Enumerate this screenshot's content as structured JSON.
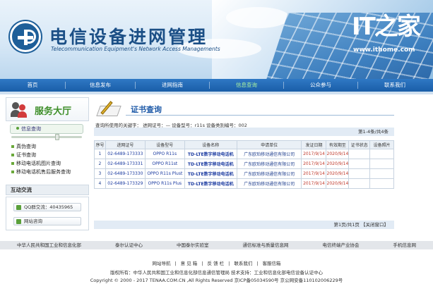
{
  "header": {
    "title": "电信设备进网管理",
    "subtitle": "Telecommunication Equipment's Network Access Managements",
    "watermark_logo": "IT之家",
    "watermark_url": "www.ithome.com"
  },
  "nav": {
    "items": [
      {
        "label": "首页",
        "active": false
      },
      {
        "label": "信息发布",
        "active": false
      },
      {
        "label": "进网指南",
        "active": false
      },
      {
        "label": "信息查询",
        "active": true
      },
      {
        "label": "公众参与",
        "active": false
      },
      {
        "label": "联系我们",
        "active": false
      }
    ]
  },
  "sidebar": {
    "service_hall": "服务大厅",
    "info_query": "信息查询",
    "menu": [
      {
        "label": "真伪查询"
      },
      {
        "label": "证书查询"
      },
      {
        "label": "移动电话机图片查询"
      },
      {
        "label": "移动电话机售后服务查询"
      }
    ],
    "exchange_title": "互动交流",
    "qq_group": "QQ群交流：40435965",
    "online_consult": "网站咨询"
  },
  "main": {
    "title": "证书查询",
    "query_keywords": "查询所使用的关键字： 进网证号：— 设备型号：r11s 设备类别编号：002",
    "pager_top": "第1-4条/共4条",
    "columns": [
      "序号",
      "进网证号",
      "设备型号",
      "设备名称",
      "申请单位",
      "发证日期",
      "有效期至",
      "证书状态",
      "设备照片"
    ],
    "rows": [
      {
        "no": "1",
        "cert": "02-6489-173333",
        "model": "OPPO R11s",
        "name": "TD-LTE数字移动电话机",
        "applicant": "广东欧珀移动通信有限公司",
        "issued": "2017/9/14",
        "valid": "2020/9/14",
        "status": "",
        "photo": ""
      },
      {
        "no": "2",
        "cert": "02-6489-173331",
        "model": "OPPO R11st",
        "name": "TD-LTE数字移动电话机",
        "applicant": "广东欧珀移动通信有限公司",
        "issued": "2017/9/14",
        "valid": "2020/9/14",
        "status": "",
        "photo": ""
      },
      {
        "no": "3",
        "cert": "02-6489-173330",
        "model": "OPPO R11s Plust",
        "name": "TD-LTE数字移动电话机",
        "applicant": "广东欧珀移动通信有限公司",
        "issued": "2017/9/14",
        "valid": "2020/9/14",
        "status": "",
        "photo": ""
      },
      {
        "no": "4",
        "cert": "02-6489-173329",
        "model": "OPPO R11s Plus",
        "name": "TD-LTE数字移动电话机",
        "applicant": "广东欧珀移动通信有限公司",
        "issued": "2017/9/14",
        "valid": "2020/9/14",
        "status": "",
        "photo": ""
      }
    ],
    "pager_bottom": "第1页/共1页",
    "close_window": "【关闭窗口】"
  },
  "footer": {
    "partners": [
      "中华人民共和国工业和信息化部",
      "泰尔认证中心",
      "中国泰尔实验室",
      "通信标准与质量信息网",
      "电信终端产业协会",
      "手机信息网"
    ],
    "links": [
      "网站导航",
      "|",
      "意 见 箱",
      "|",
      "反 馈 栏",
      "|",
      "联系我们",
      "|",
      "客服信箱"
    ],
    "copyright_owner": "版权所有：中华人民共和国工业和信息化部信息通信管理局   技术支持：工业和信息化部电信设备认证中心",
    "copyright": "Copyright © 2000 - 2017 TENAA.COM.CN ,All Rights Reserved   京ICP备05034590号 京公网安备110102006229号"
  }
}
